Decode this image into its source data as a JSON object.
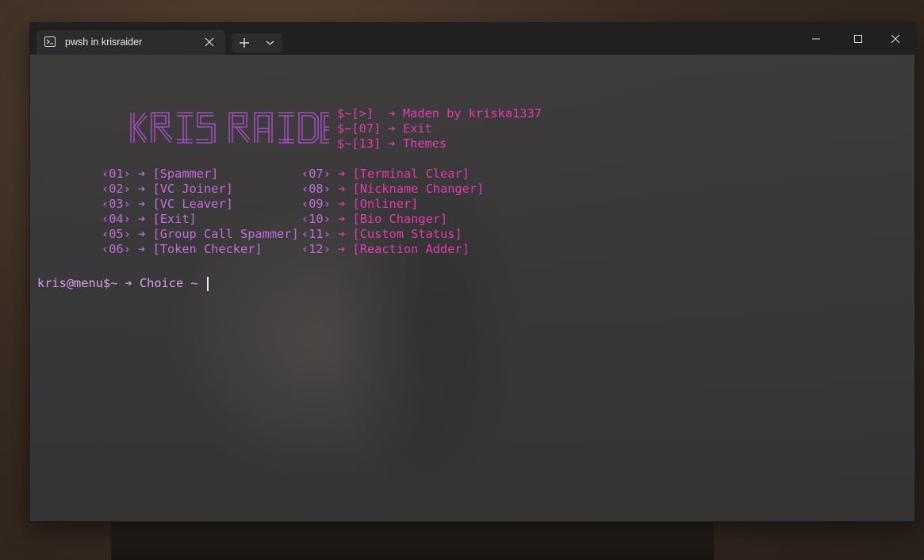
{
  "tab": {
    "title": "pwsh in krisraider",
    "icon": "powershell-icon"
  },
  "window_controls": {
    "new_tab": "+",
    "dropdown": "chevron-down-icon"
  },
  "logo": {
    "text": "KRIS RAIDER"
  },
  "header_lines": [
    {
      "prefix": "$~[>]",
      "arrow": "➔",
      "text": "Maden by kriska1337"
    },
    {
      "prefix": "$~[07]",
      "arrow": "➔",
      "text": "Exit"
    },
    {
      "prefix": "$~[13]",
      "arrow": "➔",
      "text": "Themes"
    }
  ],
  "menu_left": [
    {
      "num": "‹01›",
      "label": "[Spammer]"
    },
    {
      "num": "‹02›",
      "label": "[VC Joiner]"
    },
    {
      "num": "‹03›",
      "label": "[VC Leaver]"
    },
    {
      "num": "‹04›",
      "label": "[Exit]"
    },
    {
      "num": "‹05›",
      "label": "[Group Call Spammer]"
    },
    {
      "num": "‹06›",
      "label": "[Token Checker]"
    }
  ],
  "menu_right": [
    {
      "num": "‹07›",
      "label": "[Terminal Clear]"
    },
    {
      "num": "‹08›",
      "label": "[Nickname Changer]"
    },
    {
      "num": "‹09›",
      "label": "[Onliner]"
    },
    {
      "num": "‹10›",
      "label": "[Bio Changer]"
    },
    {
      "num": "‹11›",
      "label": "[Custom Status]"
    },
    {
      "num": "‹12›",
      "label": "[Reaction Adder]"
    }
  ],
  "arrow": "➔",
  "prompt": "kris@menu$~ ➔ Choice ~ ",
  "colors": {
    "pink": "#e23ab1",
    "violet": "#c569e0"
  }
}
